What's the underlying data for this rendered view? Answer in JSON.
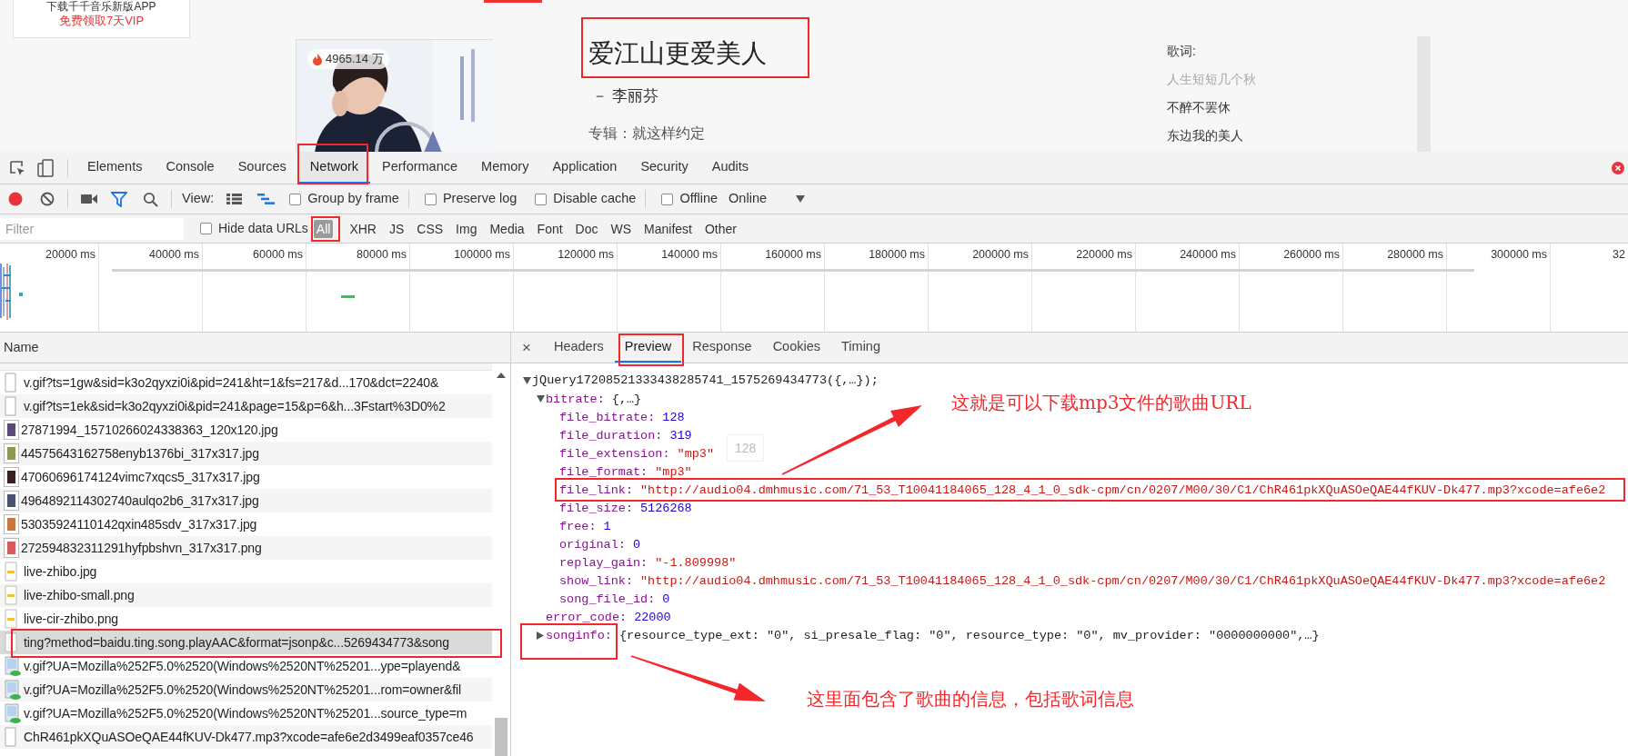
{
  "page": {
    "app_promo": [
      "下载千千音乐新版APP",
      "免费领取7天VIP"
    ],
    "play_count": "4965.14 万",
    "song_title": "爱江山更爱美人",
    "artist": "－ 李丽芬",
    "album": "专辑：就这样约定",
    "lyrics_label": "歌词:",
    "lyrics": [
      {
        "text": "人生短短几个秋",
        "faded": true
      },
      {
        "text": "不醉不罢休",
        "faded": false
      },
      {
        "text": "东边我的美人",
        "faded": false
      }
    ]
  },
  "devtools": {
    "tabs": [
      {
        "label": "Elements",
        "selected": false
      },
      {
        "label": "Console",
        "selected": false
      },
      {
        "label": "Sources",
        "selected": false
      },
      {
        "label": "Network",
        "selected": true
      },
      {
        "label": "Performance",
        "selected": false
      },
      {
        "label": "Memory",
        "selected": false
      },
      {
        "label": "Application",
        "selected": false
      },
      {
        "label": "Security",
        "selected": false
      },
      {
        "label": "Audits",
        "selected": false
      }
    ],
    "toolbar": {
      "recording": true,
      "view_label": "View:",
      "options": [
        {
          "label": "Group by frame",
          "checked": false
        },
        {
          "label": "Preserve log",
          "checked": false
        },
        {
          "label": "Disable cache",
          "checked": false
        },
        {
          "label": "Offline",
          "checked": false
        }
      ],
      "throttling": "Online"
    },
    "filter": {
      "placeholder": "Filter",
      "hide_data_urls": {
        "label": "Hide data URLs",
        "checked": false
      },
      "types": [
        {
          "label": "All",
          "selected": true
        },
        {
          "label": "XHR",
          "selected": false
        },
        {
          "label": "JS",
          "selected": false
        },
        {
          "label": "CSS",
          "selected": false
        },
        {
          "label": "Img",
          "selected": false
        },
        {
          "label": "Media",
          "selected": false
        },
        {
          "label": "Font",
          "selected": false
        },
        {
          "label": "Doc",
          "selected": false
        },
        {
          "label": "WS",
          "selected": false
        },
        {
          "label": "Manifest",
          "selected": false
        },
        {
          "label": "Other",
          "selected": false
        }
      ]
    },
    "timeline": {
      "ticks": [
        "20000 ms",
        "40000 ms",
        "60000 ms",
        "80000 ms",
        "100000 ms",
        "120000 ms",
        "140000 ms",
        "160000 ms",
        "180000 ms",
        "200000 ms",
        "220000 ms",
        "240000 ms",
        "260000 ms",
        "280000 ms",
        "300000 ms",
        "32"
      ]
    },
    "requests": {
      "column": "Name",
      "rows": [
        {
          "name": "v.gif?ts=1gw&sid=k3o2qyxzi0i&pid=241&ht=1&fs=217&d...170&dct=2240&",
          "kind": "file",
          "selected": false
        },
        {
          "name": "v.gif?ts=1ek&sid=k3o2qyxzi0i&pid=241&page=15&p=6&h...3Fstart%3D0%2",
          "kind": "file",
          "selected": false
        },
        {
          "name": "27871994_15710266024338363_120x120.jpg",
          "kind": "thumbnail",
          "color": "#5a4a78",
          "selected": false
        },
        {
          "name": "44575643162758enyb1376bi_317x317.jpg",
          "kind": "thumbnail",
          "color": "#8c9a52",
          "selected": false
        },
        {
          "name": "47060696174124vimc7xqcs5_317x317.jpg",
          "kind": "thumbnail",
          "color": "#3a1f1f",
          "selected": false
        },
        {
          "name": "4964892114302740aulqo2b6_317x317.jpg",
          "kind": "thumbnail",
          "color": "#4a5272",
          "selected": false
        },
        {
          "name": "53035924110142qxin485sdv_317x317.jpg",
          "kind": "thumbnail",
          "color": "#c8783c",
          "selected": false
        },
        {
          "name": "272594832311291hyfpbshvn_317x317.png",
          "kind": "thumbnail",
          "color": "#d85a5a",
          "selected": false
        },
        {
          "name": "live-zhibo.jpg",
          "kind": "stub",
          "selected": false
        },
        {
          "name": "live-zhibo-small.png",
          "kind": "stub",
          "selected": false
        },
        {
          "name": "live-cir-zhibo.png",
          "kind": "stub",
          "selected": false
        },
        {
          "name": "ting?method=baidu.ting.song.playAAC&format=jsonp&c...5269434773&song",
          "kind": "script",
          "selected": true
        },
        {
          "name": "v.gif?UA=Mozilla%252F5.0%2520(Windows%2520NT%25201...ype=playend&",
          "kind": "picture",
          "selected": false
        },
        {
          "name": "v.gif?UA=Mozilla%252F5.0%2520(Windows%2520NT%25201...rom=owner&fil",
          "kind": "picture",
          "selected": false
        },
        {
          "name": "v.gif?UA=Mozilla%252F5.0%2520(Windows%2520NT%25201...source_type=m",
          "kind": "picture",
          "selected": false
        },
        {
          "name": "ChR461pkXQuASOeQAE44fKUV-Dk477.mp3?xcode=afe6e2d3499eaf0357ce46",
          "kind": "file",
          "selected": false
        }
      ]
    },
    "detail": {
      "close": "×",
      "tabs": [
        {
          "label": "Headers",
          "selected": false
        },
        {
          "label": "Preview",
          "selected": true
        },
        {
          "label": "Response",
          "selected": false
        },
        {
          "label": "Cookies",
          "selected": false
        },
        {
          "label": "Timing",
          "selected": false
        }
      ],
      "tree": {
        "text": "jQuery17208521333438285741_1575269434773({,…});",
        "expanded": true,
        "children": [
          {
            "key": "bitrate:",
            "value": "{,…}",
            "kind": "preview",
            "expanded": true,
            "children": [
              {
                "key": "file_bitrate:",
                "value": "128",
                "kind": "number"
              },
              {
                "key": "file_duration:",
                "value": "319",
                "kind": "number"
              },
              {
                "key": "file_extension:",
                "value": "\"mp3\"",
                "kind": "string"
              },
              {
                "key": "file_format:",
                "value": "\"mp3\"",
                "kind": "string"
              },
              {
                "key": "file_link:",
                "value": "\"http://audio04.dmhmusic.com/71_53_T10041184065_128_4_1_0_sdk-cpm/cn/0207/M00/30/C1/ChR461pkXQuASOeQAE44fKUV-Dk477.mp3?xcode=afe6e2",
                "kind": "string"
              },
              {
                "key": "file_size:",
                "value": "5126268",
                "kind": "number"
              },
              {
                "key": "free:",
                "value": "1",
                "kind": "number"
              },
              {
                "key": "original:",
                "value": "0",
                "kind": "number"
              },
              {
                "key": "replay_gain:",
                "value": "\"-1.809998\"",
                "kind": "string"
              },
              {
                "key": "show_link:",
                "value": "\"http://audio04.dmhmusic.com/71_53_T10041184065_128_4_1_0_sdk-cpm/cn/0207/M00/30/C1/ChR461pkXQuASOeQAE44fKUV-Dk477.mp3?xcode=afe6e2",
                "kind": "string"
              },
              {
                "key": "song_file_id:",
                "value": "0",
                "kind": "number"
              }
            ]
          },
          {
            "key": "error_code:",
            "value": "22000",
            "kind": "number"
          },
          {
            "key": "songinfo:",
            "value": "{resource_type_ext: \"0\", si_presale_flag: \"0\", resource_type: \"0\", mv_provider: \"0000000000\",…}",
            "kind": "preview",
            "expanded": false
          }
        ]
      },
      "tooltip": "128"
    }
  },
  "annotations": [
    {
      "text": "这就是可以下载mp3文件的歌曲URL"
    },
    {
      "text": "这里面包含了歌曲的信息，包括歌词信息"
    }
  ]
}
